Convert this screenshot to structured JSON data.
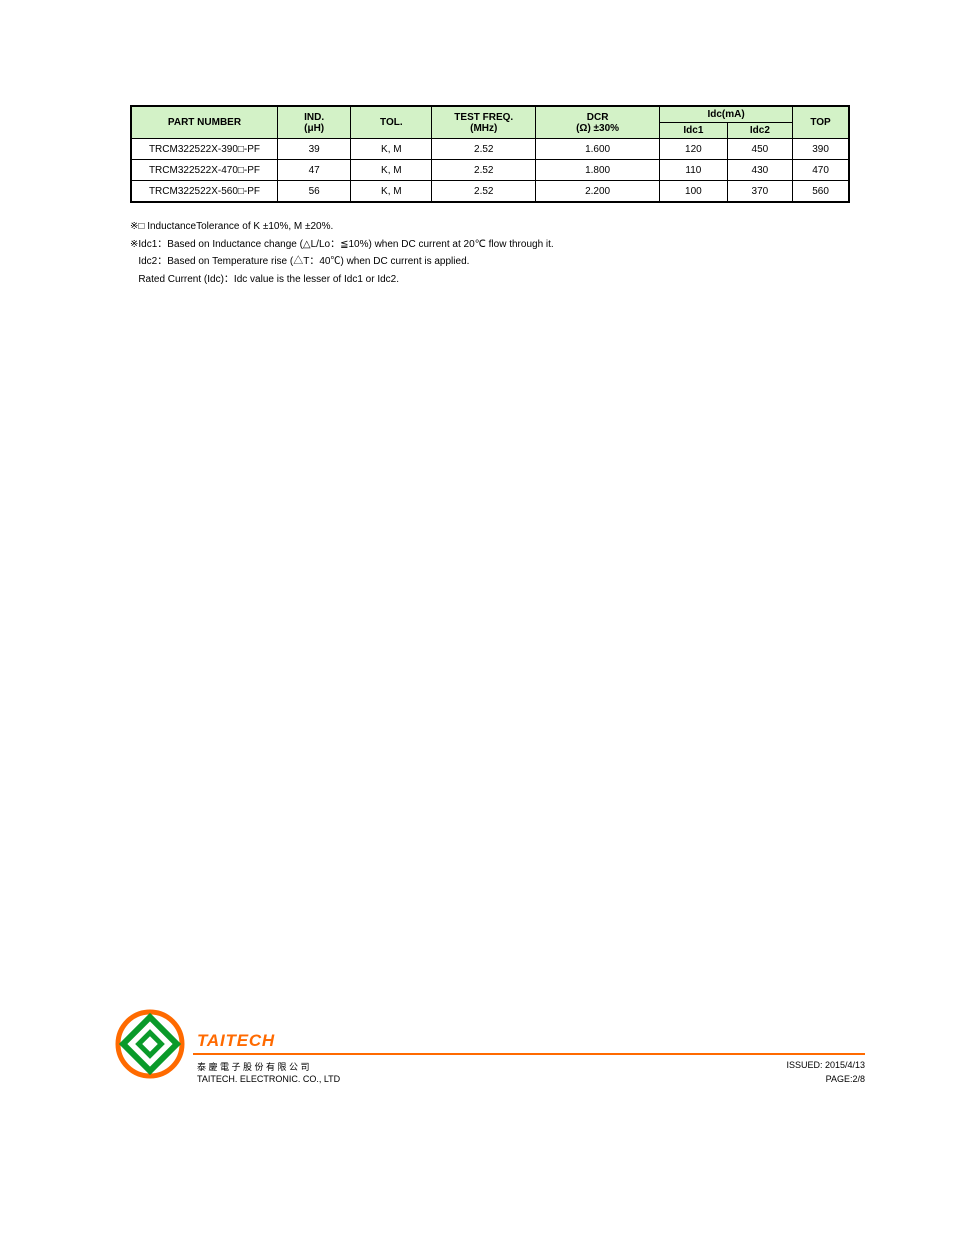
{
  "table": {
    "headers": {
      "part": "PART NUMBER",
      "ind_line1": "IND.",
      "ind_line2": "(μH)",
      "tol": "TOL.",
      "test_line1": "TEST FREQ.",
      "test_line2": "(MHz)",
      "dcr_line1": "DCR",
      "dcr_line2": "(Ω) ±30%",
      "idc_group": "Idc(mA)",
      "idc1": "Idc1",
      "idc2": "Idc2",
      "top": "TOP"
    },
    "rows": [
      {
        "part": "TRCM322522X-390□-PF",
        "ind": "39",
        "tol": "K, M",
        "freq": "2.52",
        "dcr": "1.600",
        "idc1": "120",
        "idc2": "450",
        "top": "390"
      },
      {
        "part": "TRCM322522X-470□-PF",
        "ind": "47",
        "tol": "K, M",
        "freq": "2.52",
        "dcr": "1.800",
        "idc1": "110",
        "idc2": "430",
        "top": "470"
      },
      {
        "part": "TRCM322522X-560□-PF",
        "ind": "56",
        "tol": "K, M",
        "freq": "2.52",
        "dcr": "2.200",
        "idc1": "100",
        "idc2": "370",
        "top": "560"
      }
    ]
  },
  "notes": {
    "n1": "※□ InductanceTolerance of K ±10%, M ±20%.",
    "n2": "※Idc1：Based on Inductance change (△L/Lo：≦10%) when DC current at 20℃ flow through it.",
    "n3": "   Idc2：Based on Temperature rise (△T：40℃) when DC current is applied.",
    "n4": "   Rated Current (Idc)：Idc value is the lesser of Idc1 or Idc2."
  },
  "footer": {
    "brand": "TAITECH",
    "company_tw": "泰 慶 電 子 股 份 有 限 公 司",
    "company_en": "TAITECH.  ELECTRONIC.   CO.,   LTD",
    "issue": "ISSUED: 2015/4/13",
    "page": "PAGE:2/8"
  }
}
